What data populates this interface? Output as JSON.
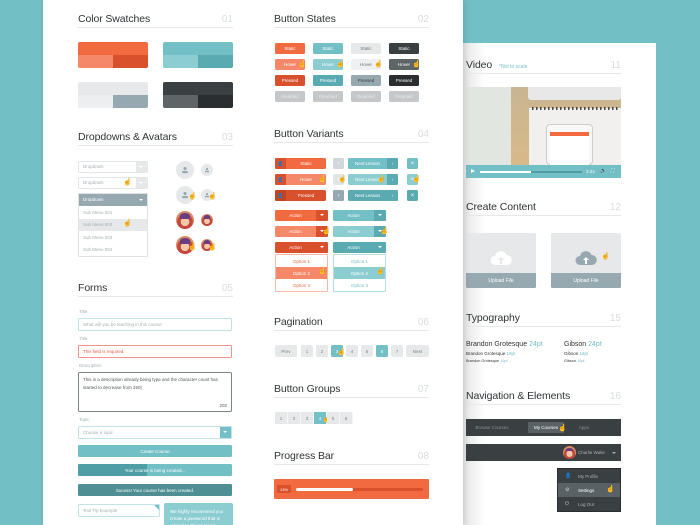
{
  "colors": {
    "orange": "#f26a3f",
    "orange_light": "#f58868",
    "orange_dark": "#d8512c",
    "teal": "#72bfc6",
    "teal_light": "#8ccdd2",
    "teal_dark": "#5aaab2",
    "grey": "#e6e8ea",
    "grey_light": "#eceeef",
    "grey_dark": "#97a9b0",
    "charcoal": "#3a3f41",
    "charcoal_light": "#5a6164",
    "charcoal_dark": "#2a2e30",
    "disabled": "#c5c8ca"
  },
  "sections": {
    "color_swatches": {
      "title": "Color Swatches",
      "num": "01"
    },
    "button_states": {
      "title": "Button States",
      "num": "02"
    },
    "dropdowns_avatars": {
      "title": "Dropdowns & Avatars",
      "num": "03"
    },
    "button_variants": {
      "title": "Button Variants",
      "num": "04"
    },
    "forms": {
      "title": "Forms",
      "num": "05"
    },
    "pagination": {
      "title": "Pagination",
      "num": "06"
    },
    "button_groups": {
      "title": "Button Groups",
      "num": "07"
    },
    "progress_bar": {
      "title": "Progress Bar",
      "num": "08"
    },
    "video": {
      "title": "Video",
      "num": "11",
      "note": "*Not to scale"
    },
    "create_content": {
      "title": "Create Content",
      "num": "12"
    },
    "typography": {
      "title": "Typography",
      "num": "15"
    },
    "navigation": {
      "title": "Navigation & Elements",
      "num": "16"
    }
  },
  "button_states": {
    "static": "Static",
    "hover": "Hover",
    "pressed": "Pressed",
    "disabled": "Disabled"
  },
  "dropdowns": {
    "label": "Dropdown",
    "items": [
      "Sub Menu 001",
      "Sub Menu 002",
      "Sub Menu 003",
      "Sub Menu 004"
    ],
    "selected_index": 1
  },
  "button_variants": {
    "static": "Static",
    "hover": "Hover",
    "pressed": "Pressed",
    "next_lesson": "Next Lesson",
    "action": "Action",
    "options": [
      "Option 1",
      "Option 2",
      "Option 3"
    ],
    "selected_option": 1
  },
  "forms": {
    "title_label": "Title",
    "title_placeholder": "What will you be teaching in this course",
    "title2_label": "Title",
    "title2_error": "This field is required.",
    "description_label": "Description",
    "description_value": "This is a description already being type and the character count has started to decrease from 250|",
    "description_count": "202",
    "topic_label": "Topic",
    "topic_placeholder": "Choose a topic",
    "create_button": "Create Course",
    "creating_status": "Your course is being created...",
    "creating_progress": 0.45,
    "success_status": "Sucess! Your course has been created.",
    "tooltip_field": "Tool Tip Example",
    "tooltip_text": "We highly recommend you create a password that is related to Chuck Norris"
  },
  "pagination": {
    "prev": "Prev",
    "next": "Next",
    "pages": [
      "1",
      "2",
      "3",
      "4",
      "5",
      "6",
      "7"
    ],
    "hover_page": "3",
    "active_page": "6"
  },
  "button_groups": {
    "items": [
      "1",
      "2",
      "3",
      "4",
      "5",
      "6"
    ],
    "active": "4"
  },
  "progress": {
    "label": "13%",
    "value": 0.45
  },
  "video": {
    "time": "3:24",
    "progress": 0.5
  },
  "create_content": {
    "upload_label": "Upload File"
  },
  "typography": {
    "fonts": [
      {
        "name": "Brandon Grotesque",
        "sizes": [
          "24pt",
          "18pt",
          "16pt"
        ]
      },
      {
        "name": "Gibson",
        "sizes": [
          "24pt",
          "18pt",
          "16pt"
        ]
      }
    ]
  },
  "navigation": {
    "items": [
      "Browse Courses",
      "My Courses",
      "Apps"
    ],
    "active": "My Courses",
    "user_name": "Charlie Waite",
    "user_menu": [
      "My Profile",
      "Settings",
      "Log Out"
    ],
    "user_menu_active": "Settings"
  }
}
